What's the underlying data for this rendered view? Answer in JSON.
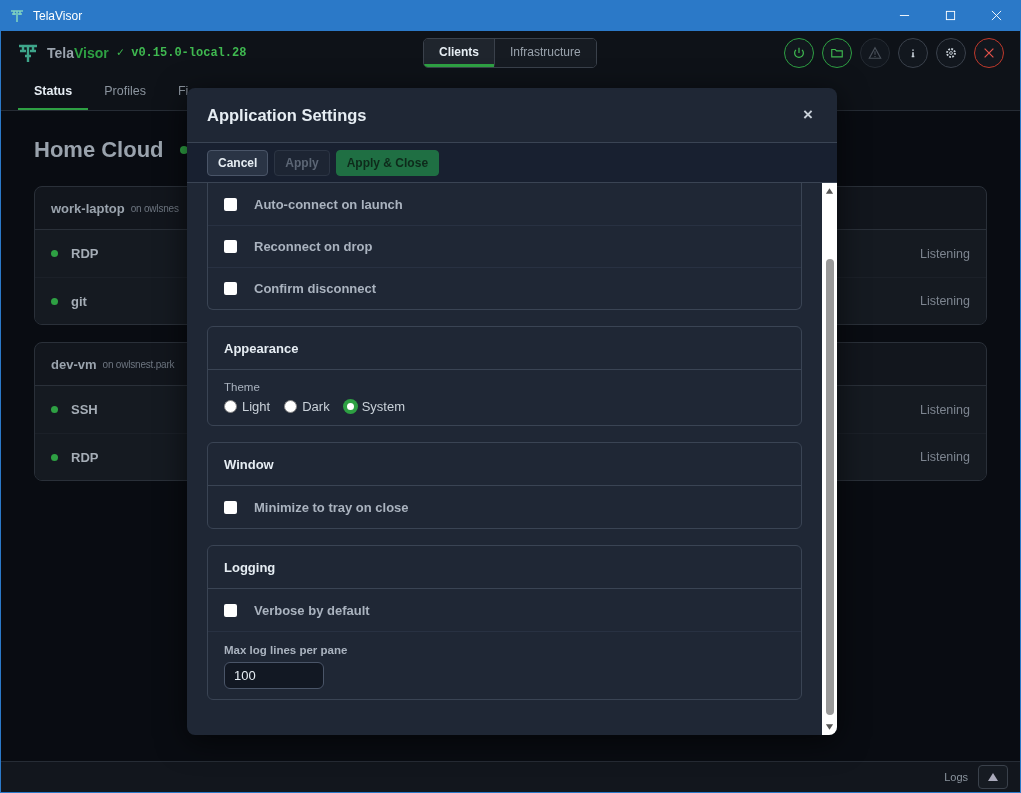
{
  "window": {
    "title": "TelaVisor"
  },
  "header": {
    "brand_first": "Tela",
    "brand_second": "Visor",
    "version": "✓ v0.15.0-local.28",
    "mode_tabs": [
      {
        "label": "Clients",
        "selected": true
      },
      {
        "label": "Infrastructure",
        "selected": false
      }
    ],
    "actions": [
      {
        "kind": "power",
        "disabled": false
      },
      {
        "kind": "folder",
        "disabled": false
      },
      {
        "kind": "warning",
        "disabled": true
      },
      {
        "kind": "info",
        "disabled": false
      },
      {
        "kind": "settings",
        "disabled": false
      },
      {
        "kind": "quit",
        "disabled": false
      }
    ]
  },
  "nav_tabs": [
    {
      "label": "Status",
      "selected": true
    },
    {
      "label": "Profiles",
      "selected": false
    },
    {
      "label": "Fi",
      "selected": false
    }
  ],
  "page": {
    "title": "Home Cloud",
    "online": true,
    "hosts": [
      {
        "name": "work-laptop",
        "location": "on owlsnes",
        "services": [
          {
            "name": "RDP",
            "status": "Listening",
            "online": true
          },
          {
            "name": "git",
            "status": "Listening",
            "online": true
          }
        ]
      },
      {
        "name": "dev-vm",
        "location": "on owlsnest.park",
        "services": [
          {
            "name": "SSH",
            "status": "Listening",
            "online": true
          },
          {
            "name": "RDP",
            "status": "Listening",
            "online": true
          }
        ]
      }
    ]
  },
  "dialog": {
    "title": "Application Settings",
    "close": "×",
    "buttons": [
      {
        "label": "Cancel",
        "kind": "secondary"
      },
      {
        "label": "Apply",
        "kind": "disabled"
      },
      {
        "label": "Apply & Close",
        "kind": "primary"
      }
    ],
    "sections": [
      {
        "items": [
          {
            "kind": "checkbox",
            "label": "Auto-connect on launch",
            "checked": false
          },
          {
            "kind": "checkbox",
            "label": "Reconnect on drop",
            "checked": false
          },
          {
            "kind": "checkbox",
            "label": "Confirm disconnect",
            "checked": false
          }
        ]
      },
      {
        "title": "Appearance",
        "items": [
          {
            "kind": "radio",
            "label": "Theme",
            "options": [
              {
                "label": "Light",
                "selected": false
              },
              {
                "label": "Dark",
                "selected": false
              },
              {
                "label": "System",
                "selected": true
              }
            ]
          }
        ]
      },
      {
        "title": "Window",
        "items": [
          {
            "kind": "checkbox",
            "label": "Minimize to tray on close",
            "checked": false
          }
        ]
      },
      {
        "title": "Logging",
        "items": [
          {
            "kind": "checkbox",
            "label": "Verbose by default",
            "checked": false
          },
          {
            "kind": "number",
            "label": "Max log lines per pane",
            "value": "100"
          }
        ]
      }
    ]
  },
  "footer": {
    "logs": "Logs"
  }
}
